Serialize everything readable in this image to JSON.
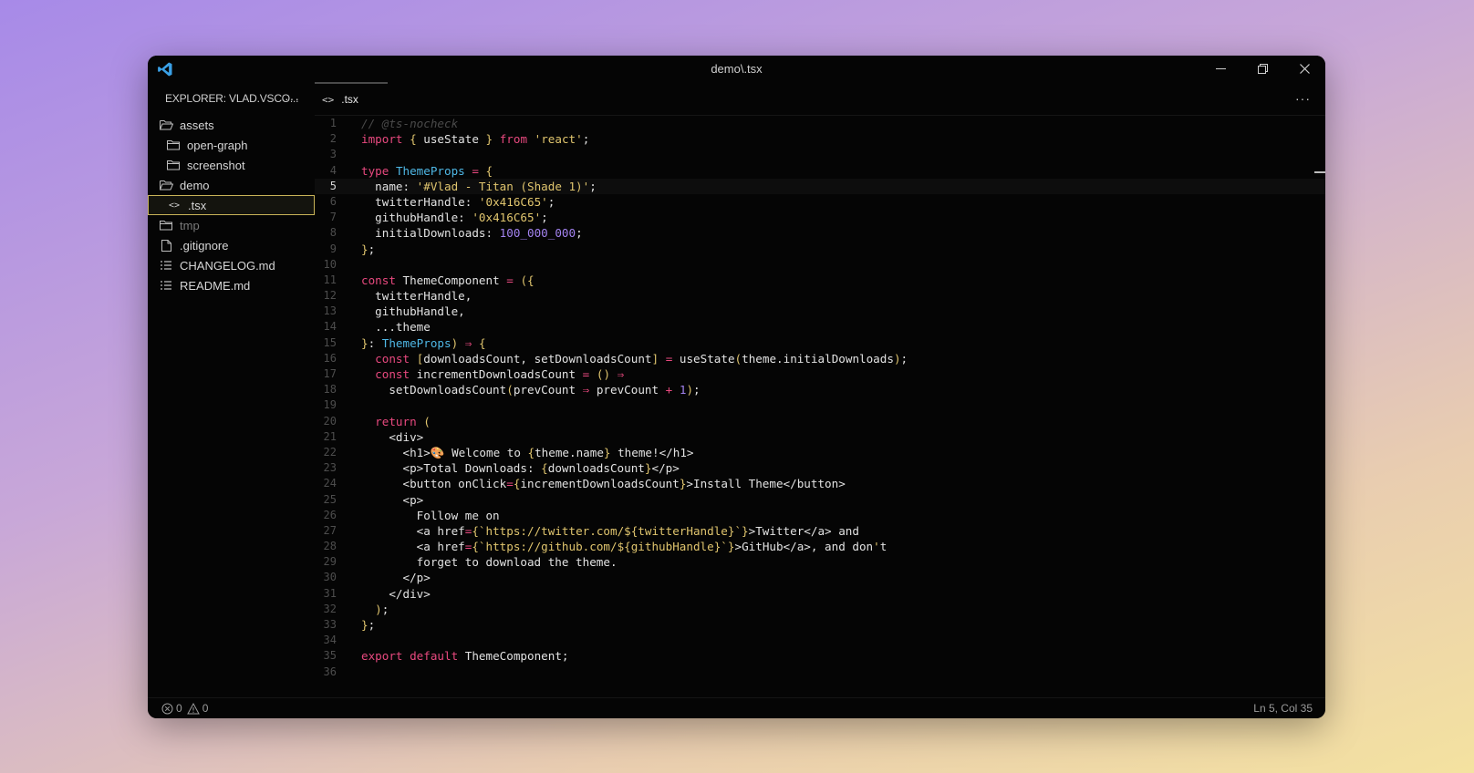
{
  "window": {
    "title": "demo\\.tsx"
  },
  "sidebar": {
    "header": "EXPLORER: VLAD.VSCO...",
    "items": [
      {
        "label": "assets",
        "icon": "folder-open-icon",
        "indent": 0
      },
      {
        "label": "open-graph",
        "icon": "folder-icon",
        "indent": 1
      },
      {
        "label": "screenshot",
        "icon": "folder-icon",
        "indent": 1
      },
      {
        "label": "demo",
        "icon": "folder-open-icon",
        "indent": 0
      },
      {
        "label": ".tsx",
        "icon": "code-file-icon",
        "indent": 1,
        "selected": true
      },
      {
        "label": "tmp",
        "icon": "folder-icon",
        "indent": 0,
        "dim": true
      },
      {
        "label": ".gitignore",
        "icon": "file-icon",
        "indent": 0
      },
      {
        "label": "CHANGELOG.md",
        "icon": "markdown-icon",
        "indent": 0
      },
      {
        "label": "README.md",
        "icon": "markdown-icon",
        "indent": 0
      }
    ]
  },
  "editor": {
    "tab_label": ".tsx",
    "current_line": 5,
    "lines": [
      "// @ts-nocheck",
      "import { useState } from 'react';",
      "",
      "type ThemeProps = {",
      "  name: '#Vlad - Titan (Shade 1)';",
      "  twitterHandle: '0x416C65';",
      "  githubHandle: '0x416C65';",
      "  initialDownloads: 100_000_000;",
      "};",
      "",
      "const ThemeComponent = ({",
      "  twitterHandle,",
      "  githubHandle,",
      "  ...theme",
      "}: ThemeProps) ⇒ {",
      "  const [downloadsCount, setDownloadsCount] = useState(theme.initialDownloads);",
      "  const incrementDownloadsCount = () ⇒",
      "    setDownloadsCount(prevCount ⇒ prevCount + 1);",
      "",
      "  return (",
      "    <div>",
      "      <h1>🎨 Welcome to {theme.name} theme!</h1>",
      "      <p>Total Downloads: {downloadsCount}</p>",
      "      <button onClick={incrementDownloadsCount}>Install Theme</button>",
      "      <p>",
      "        Follow me on",
      "        <a href={`https://twitter.com/${twitterHandle}`}>Twitter</a> and",
      "        <a href={`https://github.com/${githubHandle}`}>GitHub</a>, and don't",
      "        forget to download the theme.",
      "      </p>",
      "    </div>",
      "  );",
      "};",
      "",
      "export default ThemeComponent;",
      ""
    ]
  },
  "status": {
    "errors": "0",
    "warnings": "0",
    "position": "Ln 5, Col 35"
  },
  "colors": {
    "keyword": "#e8497f",
    "type": "#4fb8e6",
    "string": "#e0c56e",
    "number": "#a383f0",
    "function": "#b8e05a",
    "variable": "#a383f0",
    "comment": "#4a4a4a",
    "selection_border": "#c9b458"
  }
}
